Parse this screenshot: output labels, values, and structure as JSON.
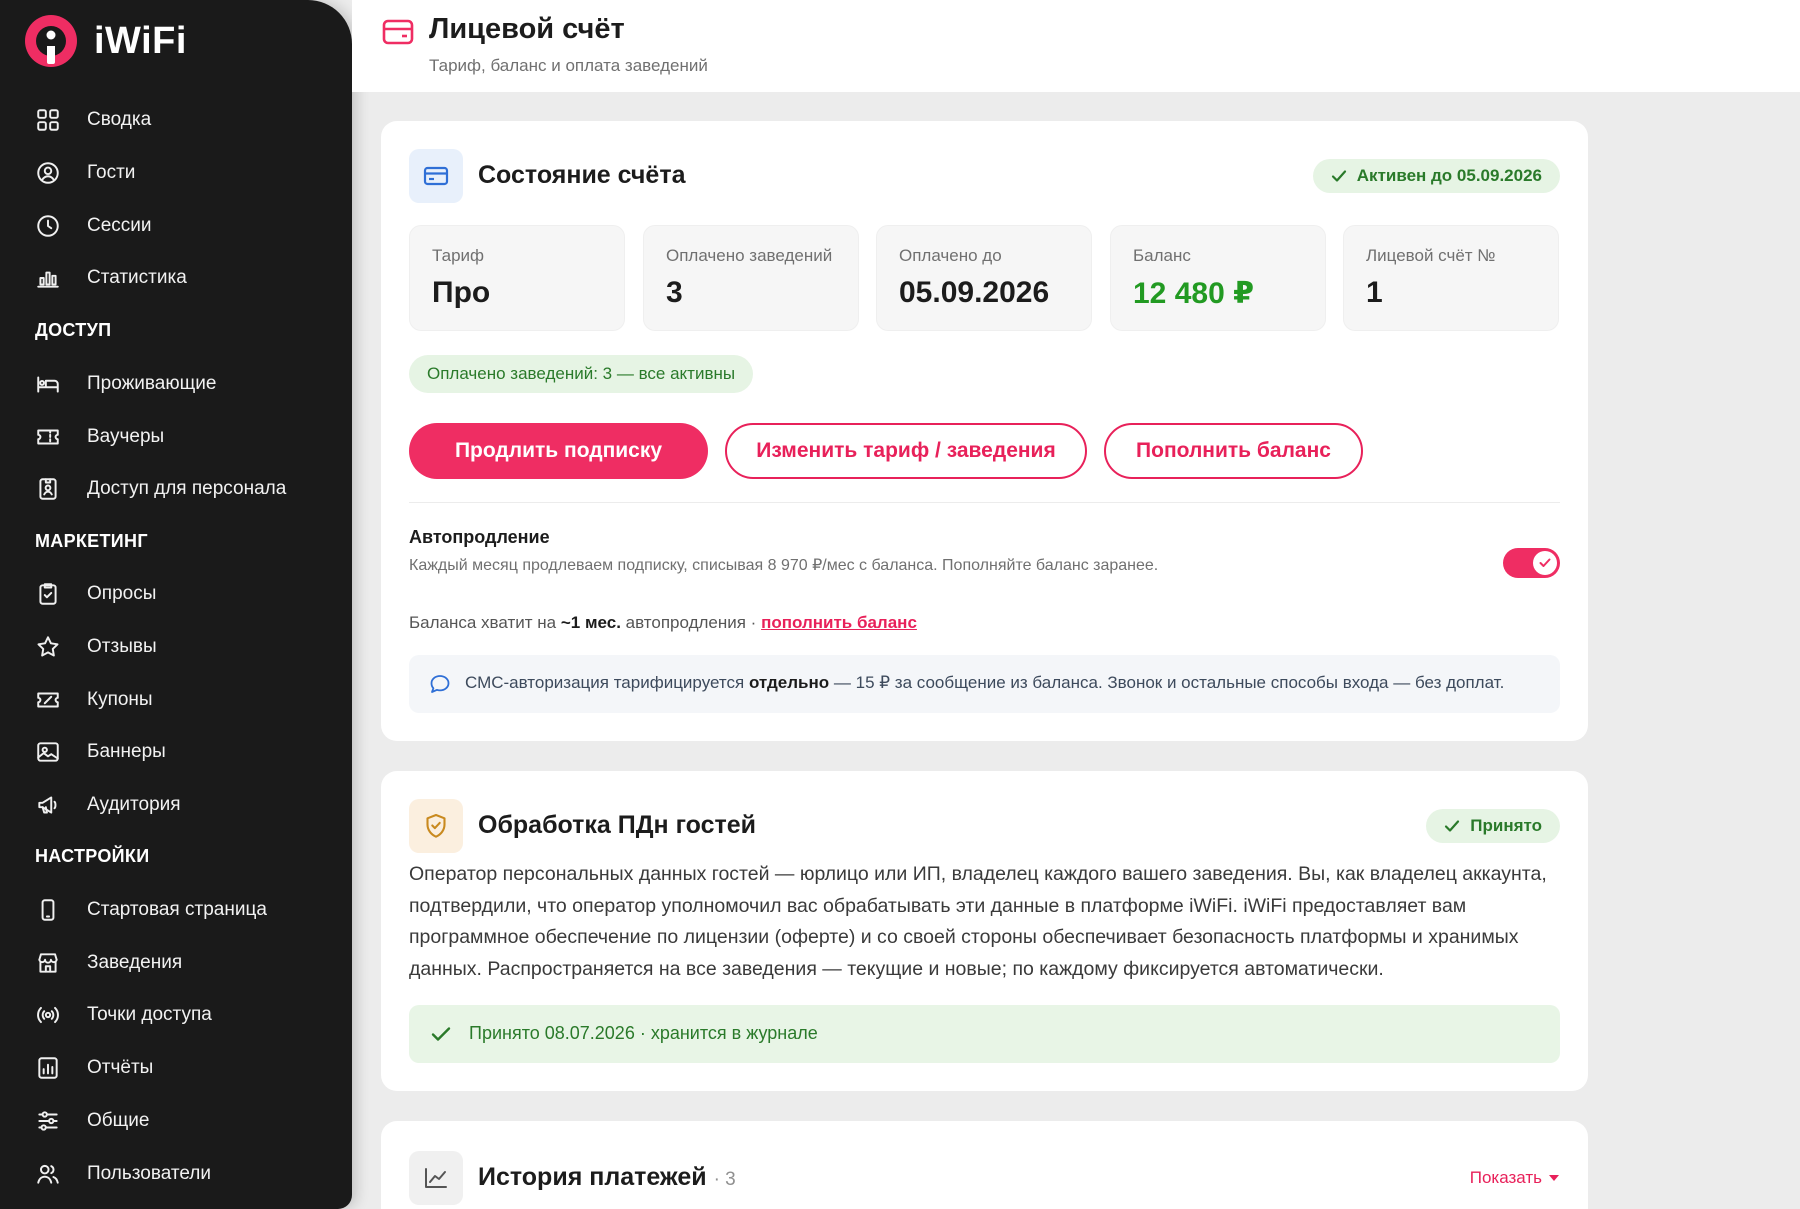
{
  "brand": {
    "name": "iWiFi",
    "accent": "#ef2d63"
  },
  "sidebar": {
    "items": [
      {
        "id": "svodka",
        "label": "Сводка",
        "icon": "dashboard-icon"
      },
      {
        "id": "gosti",
        "label": "Гости",
        "icon": "user-circle-icon"
      },
      {
        "id": "sessii",
        "label": "Сессии",
        "icon": "clock-icon"
      },
      {
        "id": "statistika",
        "label": "Статистика",
        "icon": "bar-chart-icon"
      }
    ],
    "section_access": "ДОСТУП",
    "access_items": [
      {
        "id": "prozhivayuschie",
        "label": "Проживающие",
        "icon": "bed-icon"
      },
      {
        "id": "vauchery",
        "label": "Ваучеры",
        "icon": "ticket-icon"
      },
      {
        "id": "personal",
        "label": "Доступ для персонала",
        "icon": "badge-icon"
      }
    ],
    "section_marketing": "МАРКЕТИНГ",
    "marketing_items": [
      {
        "id": "oprosy",
        "label": "Опросы",
        "icon": "clipboard-check-icon"
      },
      {
        "id": "otzyvy",
        "label": "Отзывы",
        "icon": "star-icon"
      },
      {
        "id": "kupony",
        "label": "Купоны",
        "icon": "coupon-icon"
      },
      {
        "id": "bannery",
        "label": "Баннеры",
        "icon": "image-icon"
      },
      {
        "id": "auditoriya",
        "label": "Аудитория",
        "icon": "megaphone-icon"
      }
    ],
    "section_settings": "НАСТРОЙКИ",
    "settings_items": [
      {
        "id": "start",
        "label": "Стартовая страница",
        "icon": "phone-icon"
      },
      {
        "id": "zavedeniya",
        "label": "Заведения",
        "icon": "store-icon"
      },
      {
        "id": "tochki",
        "label": "Точки доступа",
        "icon": "radio-icon"
      },
      {
        "id": "otchety",
        "label": "Отчёты",
        "icon": "report-icon"
      },
      {
        "id": "obschie",
        "label": "Общие",
        "icon": "sliders-icon"
      },
      {
        "id": "polzovateli",
        "label": "Пользователи",
        "icon": "users-icon"
      }
    ]
  },
  "header": {
    "title": "Лицевой счёт",
    "subtitle": "Тариф, баланс и оплата заведений",
    "icon": "wallet-icon"
  },
  "account": {
    "title": "Состояние счёта",
    "status_badge": "Активен до 05.09.2026",
    "stats": [
      {
        "label": "Тариф",
        "value": "Про"
      },
      {
        "label": "Оплачено заведений",
        "value": "3"
      },
      {
        "label": "Оплачено до",
        "value": "05.09.2026"
      },
      {
        "label": "Баланс",
        "value": "12 480 ₽"
      },
      {
        "label": "Лицевой счёт №",
        "value": "1"
      }
    ],
    "paid_pill": "Оплачено заведений: 3 — все активны",
    "buttons": {
      "extend": "Продлить подписку",
      "change": "Изменить тариф / заведения",
      "topup": "Пополнить баланс"
    },
    "autorenew": {
      "title": "Автопродление",
      "description": "Каждый месяц продлеваем подписку, списывая 8 970 ₽/мес с баланса. Пополняйте баланс заранее.",
      "enabled": true
    },
    "enough": {
      "prefix": "Баланса хватит на",
      "bold": "~1 мес.",
      "middle": "автопродления ·",
      "link": "пополнить баланс"
    },
    "sms": {
      "prefix": "СМС-авторизация тарифицируется",
      "bold": "отдельно",
      "suffix": "— 15 ₽ за сообщение из баланса. Звонок и остальные способы входа — без доплат."
    }
  },
  "pdn": {
    "title": "Обработка ПДн гостей",
    "status_badge": "Принято",
    "text": "Оператор персональных данных гостей — юрлицо или ИП, владелец каждого вашего заведения. Вы, как владелец аккаунта, подтвердили, что оператор уполномочил вас обрабатывать эти данные в платформе iWiFi. iWiFi предоставляет вам программное обеспечение по лицензии (оферте) и со своей стороны обеспечивает безопасность платформы и хранимых данных. Распространяется на все заведения — текущие и новые; по каждому фиксируется автоматически.",
    "accepted": "Принято 08.07.2026 · хранится в журнале"
  },
  "history": {
    "title": "История платежей",
    "count": "· 3",
    "show": "Показать"
  }
}
